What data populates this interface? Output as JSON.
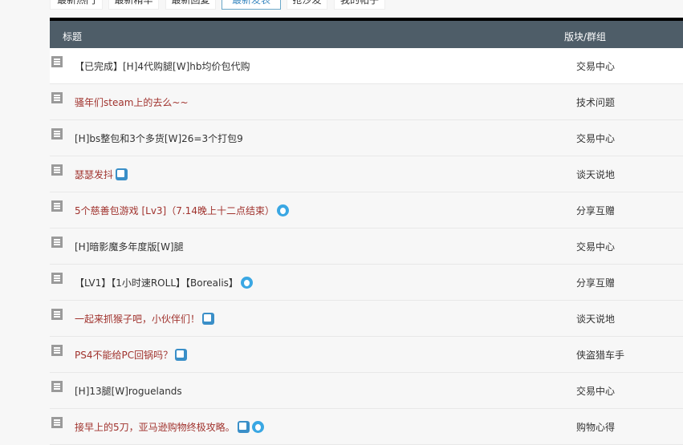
{
  "tabs": [
    {
      "label": "最新热门"
    },
    {
      "label": "最新精华"
    },
    {
      "label": "最新回复"
    },
    {
      "label": "最新发表",
      "active": true
    },
    {
      "label": "抢沙发"
    },
    {
      "label": "我的帖子"
    }
  ],
  "header": {
    "title": "标题",
    "board": "版块/群组"
  },
  "rows": [
    {
      "title": "【已完成】[H]4代购腿[W]hb均价包代购",
      "board": "交易中心",
      "red": false,
      "icons": []
    },
    {
      "title": "骚年们steam上的去么~~",
      "board": "技术问题",
      "red": true,
      "icons": []
    },
    {
      "title": "[H]bs整包和3个多货[W]26=3个打包9",
      "board": "交易中心",
      "red": false,
      "icons": []
    },
    {
      "title": "瑟瑟发抖",
      "board": "谈天说地",
      "red": true,
      "icons": [
        "image-icon"
      ]
    },
    {
      "title": "5个慈善包游戏 [Lv3]（7.14晚上十二点结束）",
      "board": "分享互赠",
      "red": true,
      "icons": [
        "hot-icon"
      ]
    },
    {
      "title": "[H]暗影魔多年度版[W]腿",
      "board": "交易中心",
      "red": false,
      "icons": []
    },
    {
      "title": "【LV1】【1小时速ROLL】【Borealis】",
      "board": "分享互赠",
      "red": false,
      "icons": [
        "hot-icon"
      ]
    },
    {
      "title": "一起来抓猴子吧，小伙伴们！",
      "board": "谈天说地",
      "red": true,
      "icons": [
        "image-icon"
      ]
    },
    {
      "title": "PS4不能给PC回锅吗？",
      "board": "侠盗猎车手",
      "red": true,
      "icons": [
        "image-icon"
      ]
    },
    {
      "title": "[H]13腿[W]roguelands",
      "board": "交易中心",
      "red": false,
      "icons": []
    },
    {
      "title": "接早上的5刀，亚马逊购物终极攻略。",
      "board": "购物心得",
      "red": true,
      "icons": [
        "image-icon",
        "hot-icon"
      ]
    }
  ]
}
